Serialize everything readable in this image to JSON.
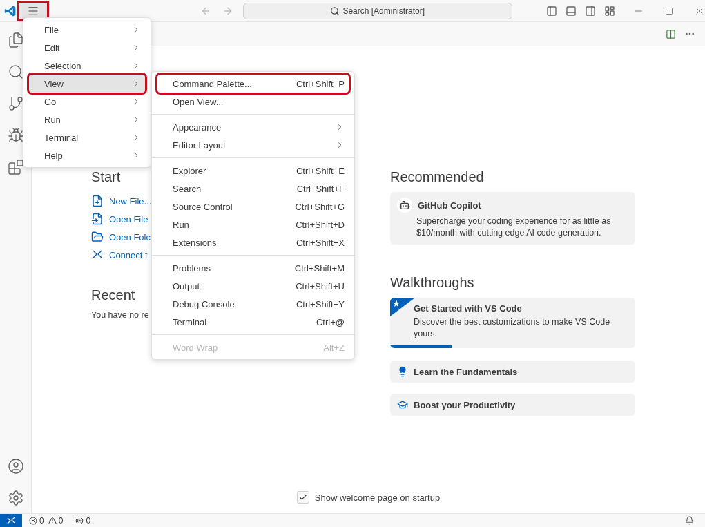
{
  "title_bar": {
    "menu_button": {
      "highlighted": true
    },
    "search": "Search [Administrator]"
  },
  "start": {
    "heading": "Start",
    "items": [
      {
        "kind": "new-file",
        "label": "New File..."
      },
      {
        "kind": "open-file",
        "label": "Open File"
      },
      {
        "kind": "open-folder",
        "label": "Open Folc"
      },
      {
        "kind": "connect",
        "label": "Connect t"
      }
    ]
  },
  "recent": {
    "heading": "Recent",
    "text": "You have no re"
  },
  "recommended": {
    "heading": "Recommended",
    "card": {
      "title": "GitHub Copilot",
      "description": "Supercharge your coding experience for as little as $10/month with cutting edge AI code generation."
    }
  },
  "walkthroughs": {
    "heading": "Walkthroughs",
    "items": [
      {
        "kind": "featured",
        "title": "Get Started with VS Code",
        "description": "Discover the best customizations to make VS Code yours.",
        "level": 0.25
      },
      {
        "kind": "bulb",
        "title": "Learn the Fundamentals"
      },
      {
        "kind": "cap",
        "title": "Boost your Productivity"
      }
    ]
  },
  "footer": {
    "label": "Show welcome page on startup",
    "checked": true
  },
  "status_bar": {
    "errors": "0",
    "warnings": "0",
    "ports": "0"
  },
  "menu": {
    "items": [
      {
        "label": "File",
        "selected": false,
        "highlighted": false
      },
      {
        "label": "Edit",
        "selected": false,
        "highlighted": false
      },
      {
        "label": "Selection",
        "selected": false,
        "highlighted": false
      },
      {
        "label": "View",
        "selected": true,
        "highlighted": true
      },
      {
        "label": "Go",
        "selected": false,
        "highlighted": false
      },
      {
        "label": "Run",
        "selected": false,
        "highlighted": false
      },
      {
        "label": "Terminal",
        "selected": false,
        "highlighted": false
      },
      {
        "label": "Help",
        "selected": false,
        "highlighted": false
      }
    ]
  },
  "submenu": {
    "groups": [
      [
        {
          "label": "Command Palette...",
          "shortcut": "Ctrl+Shift+P",
          "highlighted": true,
          "disabled": false
        },
        {
          "label": "Open View...",
          "highlighted": false,
          "disabled": false
        }
      ],
      [
        {
          "label": "Appearance",
          "has_submenu": true,
          "highlighted": false,
          "disabled": false
        },
        {
          "label": "Editor Layout",
          "has_submenu": true,
          "highlighted": false,
          "disabled": false
        }
      ],
      [
        {
          "label": "Explorer",
          "shortcut": "Ctrl+Shift+E",
          "highlighted": false,
          "disabled": false
        },
        {
          "label": "Search",
          "shortcut": "Ctrl+Shift+F",
          "highlighted": false,
          "disabled": false
        },
        {
          "label": "Source Control",
          "shortcut": "Ctrl+Shift+G",
          "highlighted": false,
          "disabled": false
        },
        {
          "label": "Run",
          "shortcut": "Ctrl+Shift+D",
          "highlighted": false,
          "disabled": false
        },
        {
          "label": "Extensions",
          "shortcut": "Ctrl+Shift+X",
          "highlighted": false,
          "disabled": false
        }
      ],
      [
        {
          "label": "Problems",
          "shortcut": "Ctrl+Shift+M",
          "highlighted": false,
          "disabled": false
        },
        {
          "label": "Output",
          "shortcut": "Ctrl+Shift+U",
          "highlighted": false,
          "disabled": false
        },
        {
          "label": "Debug Console",
          "shortcut": "Ctrl+Shift+Y",
          "highlighted": false,
          "disabled": false
        },
        {
          "label": "Terminal",
          "shortcut": "Ctrl+@",
          "highlighted": false,
          "disabled": false
        }
      ],
      [
        {
          "label": "Word Wrap",
          "shortcut": "Alt+Z",
          "highlighted": false,
          "disabled": true
        }
      ]
    ]
  }
}
